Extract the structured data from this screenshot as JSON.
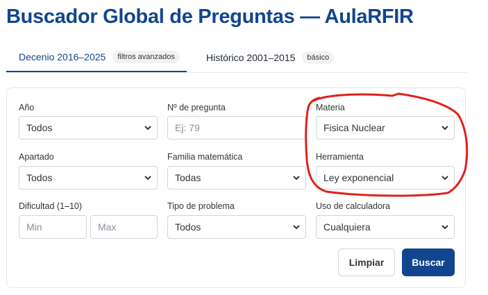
{
  "header": {
    "title": "Buscador Global de Preguntas — AulaRFIR"
  },
  "tabs": [
    {
      "label": "Decenio 2016–2025",
      "badge": "filtros avanzados",
      "active": true
    },
    {
      "label": "Histórico 2001–2015",
      "badge": "básico",
      "active": false
    }
  ],
  "filters": {
    "anio": {
      "label": "Año",
      "value": "Todos"
    },
    "num_pregunta": {
      "label": "Nº de pregunta",
      "placeholder": "Ej: 79"
    },
    "materia": {
      "label": "Materia",
      "value": "Fisica Nuclear"
    },
    "apartado": {
      "label": "Apartado",
      "value": "Todos"
    },
    "familia": {
      "label": "Familia matemática",
      "value": "Todas"
    },
    "herramienta": {
      "label": "Herramienta",
      "value": "Ley exponencial"
    },
    "dificultad": {
      "label": "Dificultad (1–10)",
      "min_placeholder": "Min",
      "max_placeholder": "Max"
    },
    "tipo": {
      "label": "Tipo de problema",
      "value": "Todos"
    },
    "calculadora": {
      "label": "Uso de calculadora",
      "value": "Cualquiera"
    }
  },
  "actions": {
    "clear_label": "Limpiar",
    "search_label": "Buscar"
  },
  "colors": {
    "accent": "#12458e",
    "annotation": "#e0201b"
  },
  "icons": {
    "select_arrow": "chevron-down-icon"
  }
}
